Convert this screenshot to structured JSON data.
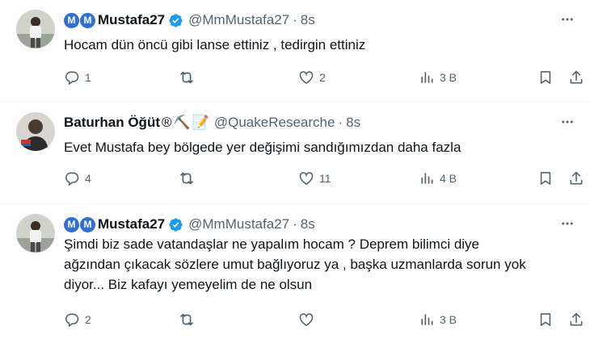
{
  "tweets": [
    {
      "badges": [
        "M",
        "M"
      ],
      "name": "Mustafa27",
      "handle": "@MmMustafa27",
      "separator": "·",
      "time": "8s",
      "text": "Hocam dün öncü gibi lanse ettiniz , tedirgin ettiniz",
      "replies": "1",
      "retweets": "",
      "likes": "2",
      "views": "3 B"
    },
    {
      "badges": [],
      "name": "Baturhan Öğüt",
      "name_suffix": "®",
      "emojis": [
        "⛏️",
        "📝"
      ],
      "handle": "@QuakeResearche",
      "separator": "·",
      "time": "8s",
      "text": "Evet Mustafa bey bölgede yer değişimi sandığımızdan daha fazla",
      "replies": "4",
      "retweets": "",
      "likes": "11",
      "views": "4 B"
    },
    {
      "badges": [
        "M",
        "M"
      ],
      "name": "Mustafa27",
      "handle": "@MmMustafa27",
      "separator": "·",
      "time": "8s",
      "text_lines": [
        "Şimdi biz sade vatandaşlar ne yapalım hocam ? Deprem bilimci diye",
        "ağzından çıkacak sözlere umut bağlıyoruz ya , başka uzmanlarda sorun yok",
        "diyor... Biz kafayı yemeyelim de ne olsun"
      ],
      "replies": "2",
      "retweets": "",
      "likes": "",
      "views": "3 B"
    }
  ],
  "icons": {
    "reply": "reply-icon",
    "retweet": "retweet-icon",
    "like": "heart-icon",
    "views": "views-icon",
    "bookmark": "bookmark-icon",
    "share": "share-icon",
    "more": "more-icon",
    "verified": "verified-badge-icon"
  },
  "colors": {
    "verified": "#1d9bf0",
    "badge": "#2f6fd6",
    "muted": "#536471",
    "text": "#0f1419"
  }
}
